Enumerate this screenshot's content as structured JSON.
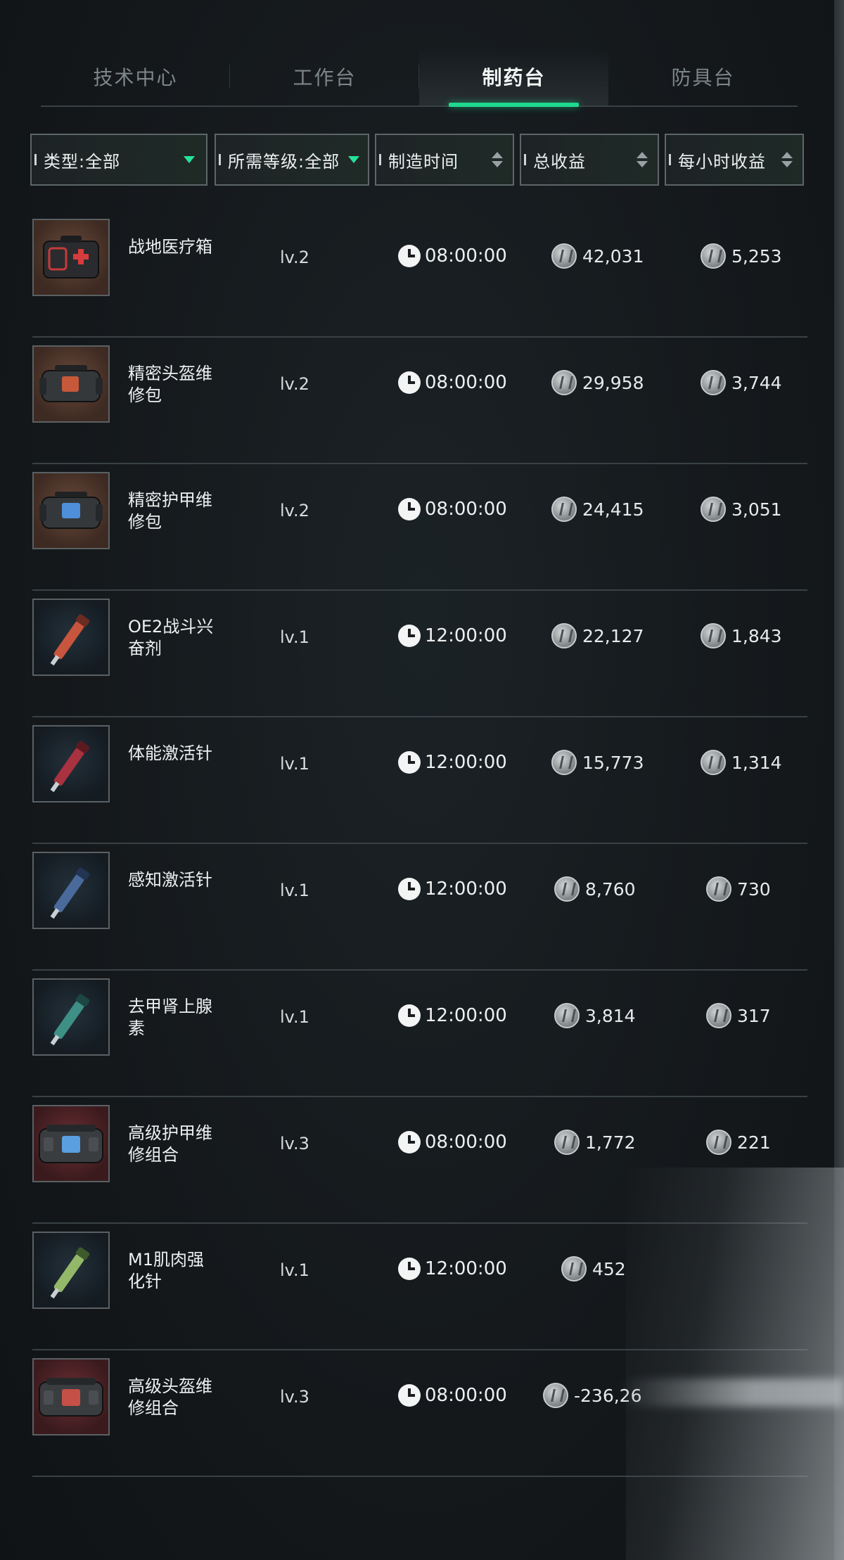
{
  "tabs": [
    {
      "label": "技术中心",
      "active": false
    },
    {
      "label": "工作台",
      "active": false
    },
    {
      "label": "制药台",
      "active": true
    },
    {
      "label": "防具台",
      "active": false
    }
  ],
  "filters": {
    "type": "类型:全部",
    "level": "所需等级:全部",
    "craft_time": "制造时间",
    "total_profit": "总收益",
    "hourly_profit": "每小时收益"
  },
  "colors": {
    "accent": "#1fd98f"
  },
  "items": [
    {
      "name": "战地医疗箱",
      "level": "lv.2",
      "time": "08:00:00",
      "total": "42,031",
      "hourly": "5,253",
      "icon": "medkit-icon"
    },
    {
      "name": "精密头盔维修包",
      "level": "lv.2",
      "time": "08:00:00",
      "total": "29,958",
      "hourly": "3,744",
      "icon": "helmet-repair-kit-icon"
    },
    {
      "name": "精密护甲维修包",
      "level": "lv.2",
      "time": "08:00:00",
      "total": "24,415",
      "hourly": "3,051",
      "icon": "armor-repair-kit-icon"
    },
    {
      "name": "OE2战斗兴奋剂",
      "level": "lv.1",
      "time": "12:00:00",
      "total": "22,127",
      "hourly": "1,843",
      "icon": "syringe-orange-icon"
    },
    {
      "name": "体能激活针",
      "level": "lv.1",
      "time": "12:00:00",
      "total": "15,773",
      "hourly": "1,314",
      "icon": "syringe-red-icon"
    },
    {
      "name": "感知激活针",
      "level": "lv.1",
      "time": "12:00:00",
      "total": "8,760",
      "hourly": "730",
      "icon": "syringe-blue-icon"
    },
    {
      "name": "去甲肾上腺素",
      "level": "lv.1",
      "time": "12:00:00",
      "total": "3,814",
      "hourly": "317",
      "icon": "syringe-teal-icon"
    },
    {
      "name": "高级护甲维修组合",
      "level": "lv.3",
      "time": "08:00:00",
      "total": "1,772",
      "hourly": "221",
      "icon": "armor-repair-combo-icon"
    },
    {
      "name": "M1肌肉强化针",
      "level": "lv.1",
      "time": "12:00:00",
      "total": "452",
      "hourly": "",
      "icon": "syringe-green-icon"
    },
    {
      "name": "高级头盔维修组合",
      "level": "lv.3",
      "time": "08:00:00",
      "total": "-236,26",
      "hourly": "",
      "icon": "helmet-repair-combo-icon"
    }
  ]
}
